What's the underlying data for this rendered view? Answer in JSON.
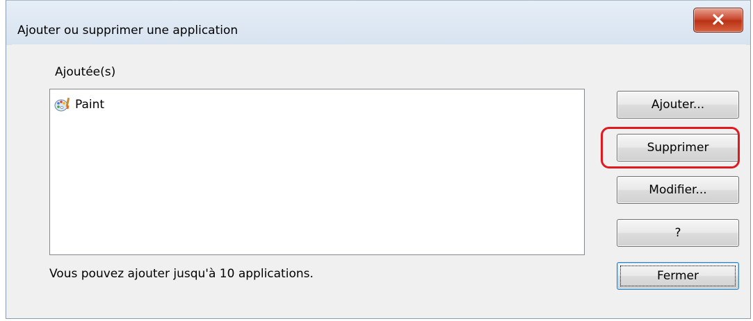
{
  "window": {
    "title": "Ajouter ou supprimer une application"
  },
  "list": {
    "label": "Ajoutée(s)",
    "items": [
      {
        "label": "Paint",
        "icon": "paint-palette-icon"
      }
    ]
  },
  "buttons": {
    "add": "Ajouter...",
    "remove": "Supprimer",
    "modify": "Modifier...",
    "help": "?",
    "close": "Fermer"
  },
  "footer": {
    "note": "Vous pouvez ajouter jusqu'à 10 applications."
  },
  "colors": {
    "highlight": "#e0191f",
    "close_button": "#c9432a"
  }
}
